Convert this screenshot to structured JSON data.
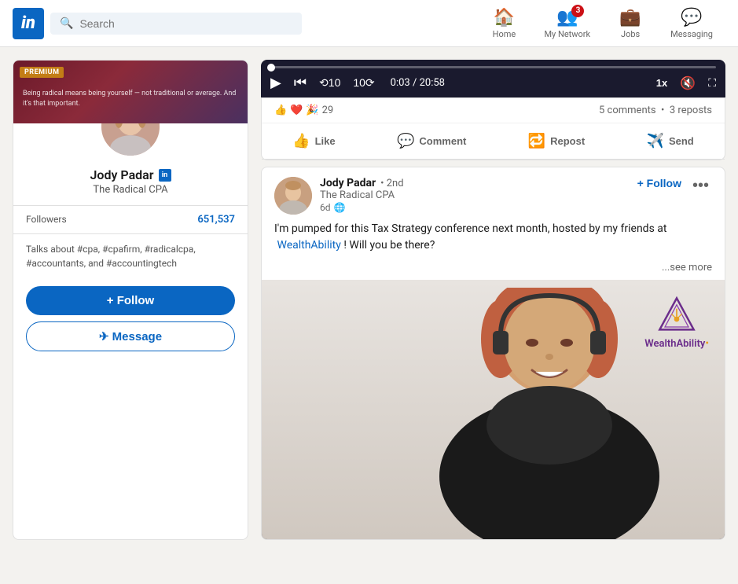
{
  "header": {
    "logo_text": "in",
    "search_placeholder": "Search",
    "nav_items": [
      {
        "id": "home",
        "label": "Home",
        "icon": "🏠",
        "badge": null
      },
      {
        "id": "my-network",
        "label": "My Network",
        "icon": "👥",
        "badge": "3"
      },
      {
        "id": "jobs",
        "label": "Jobs",
        "icon": "💼",
        "badge": null
      },
      {
        "id": "messaging",
        "label": "Messaging",
        "icon": "💬",
        "badge": null
      }
    ]
  },
  "profile_card": {
    "premium_badge": "PREMIUM",
    "banner_text": "Being radical means being yourself — not traditional or average. And it's that important.",
    "name": "Jody Padar",
    "in_badge": "in",
    "title": "The Radical CPA",
    "followers_label": "Followers",
    "followers_count": "651,537",
    "tags": "Talks about #cpa, #cpafirm, #radicalcpa, #accountants, and #accountingtech",
    "follow_btn": "+ Follow",
    "message_btn": "✈ Message"
  },
  "video_player": {
    "time_current": "0:03",
    "time_total": "20:58",
    "speed": "1x"
  },
  "post_reactions": {
    "count": "29",
    "comments": "5 comments",
    "reposts": "3 reposts",
    "actions": [
      {
        "id": "like",
        "label": "Like",
        "icon": "👍"
      },
      {
        "id": "comment",
        "label": "Comment",
        "icon": "💬"
      },
      {
        "id": "repost",
        "label": "Repost",
        "icon": "🔁"
      },
      {
        "id": "send",
        "label": "Send",
        "icon": "✈"
      }
    ]
  },
  "post_2": {
    "author": "Jody Padar",
    "degree": "2nd",
    "subtitle": "The Radical CPA",
    "time": "6d",
    "visibility": "🌐",
    "follow_btn": "+ Follow",
    "body_text": "I'm pumped for this Tax Strategy conference next month, hosted by my friends at",
    "body_link": "WealthAbility",
    "body_suffix": "! Will you be there?",
    "see_more": "...see more",
    "wealth_ability_label": "WealthAbility"
  },
  "colors": {
    "linkedin_blue": "#0a66c2",
    "premium_gold": "#c37d16",
    "brand_red": "#cc1016",
    "purple": "#6b2d8b",
    "gold_dot": "#e8a020"
  }
}
